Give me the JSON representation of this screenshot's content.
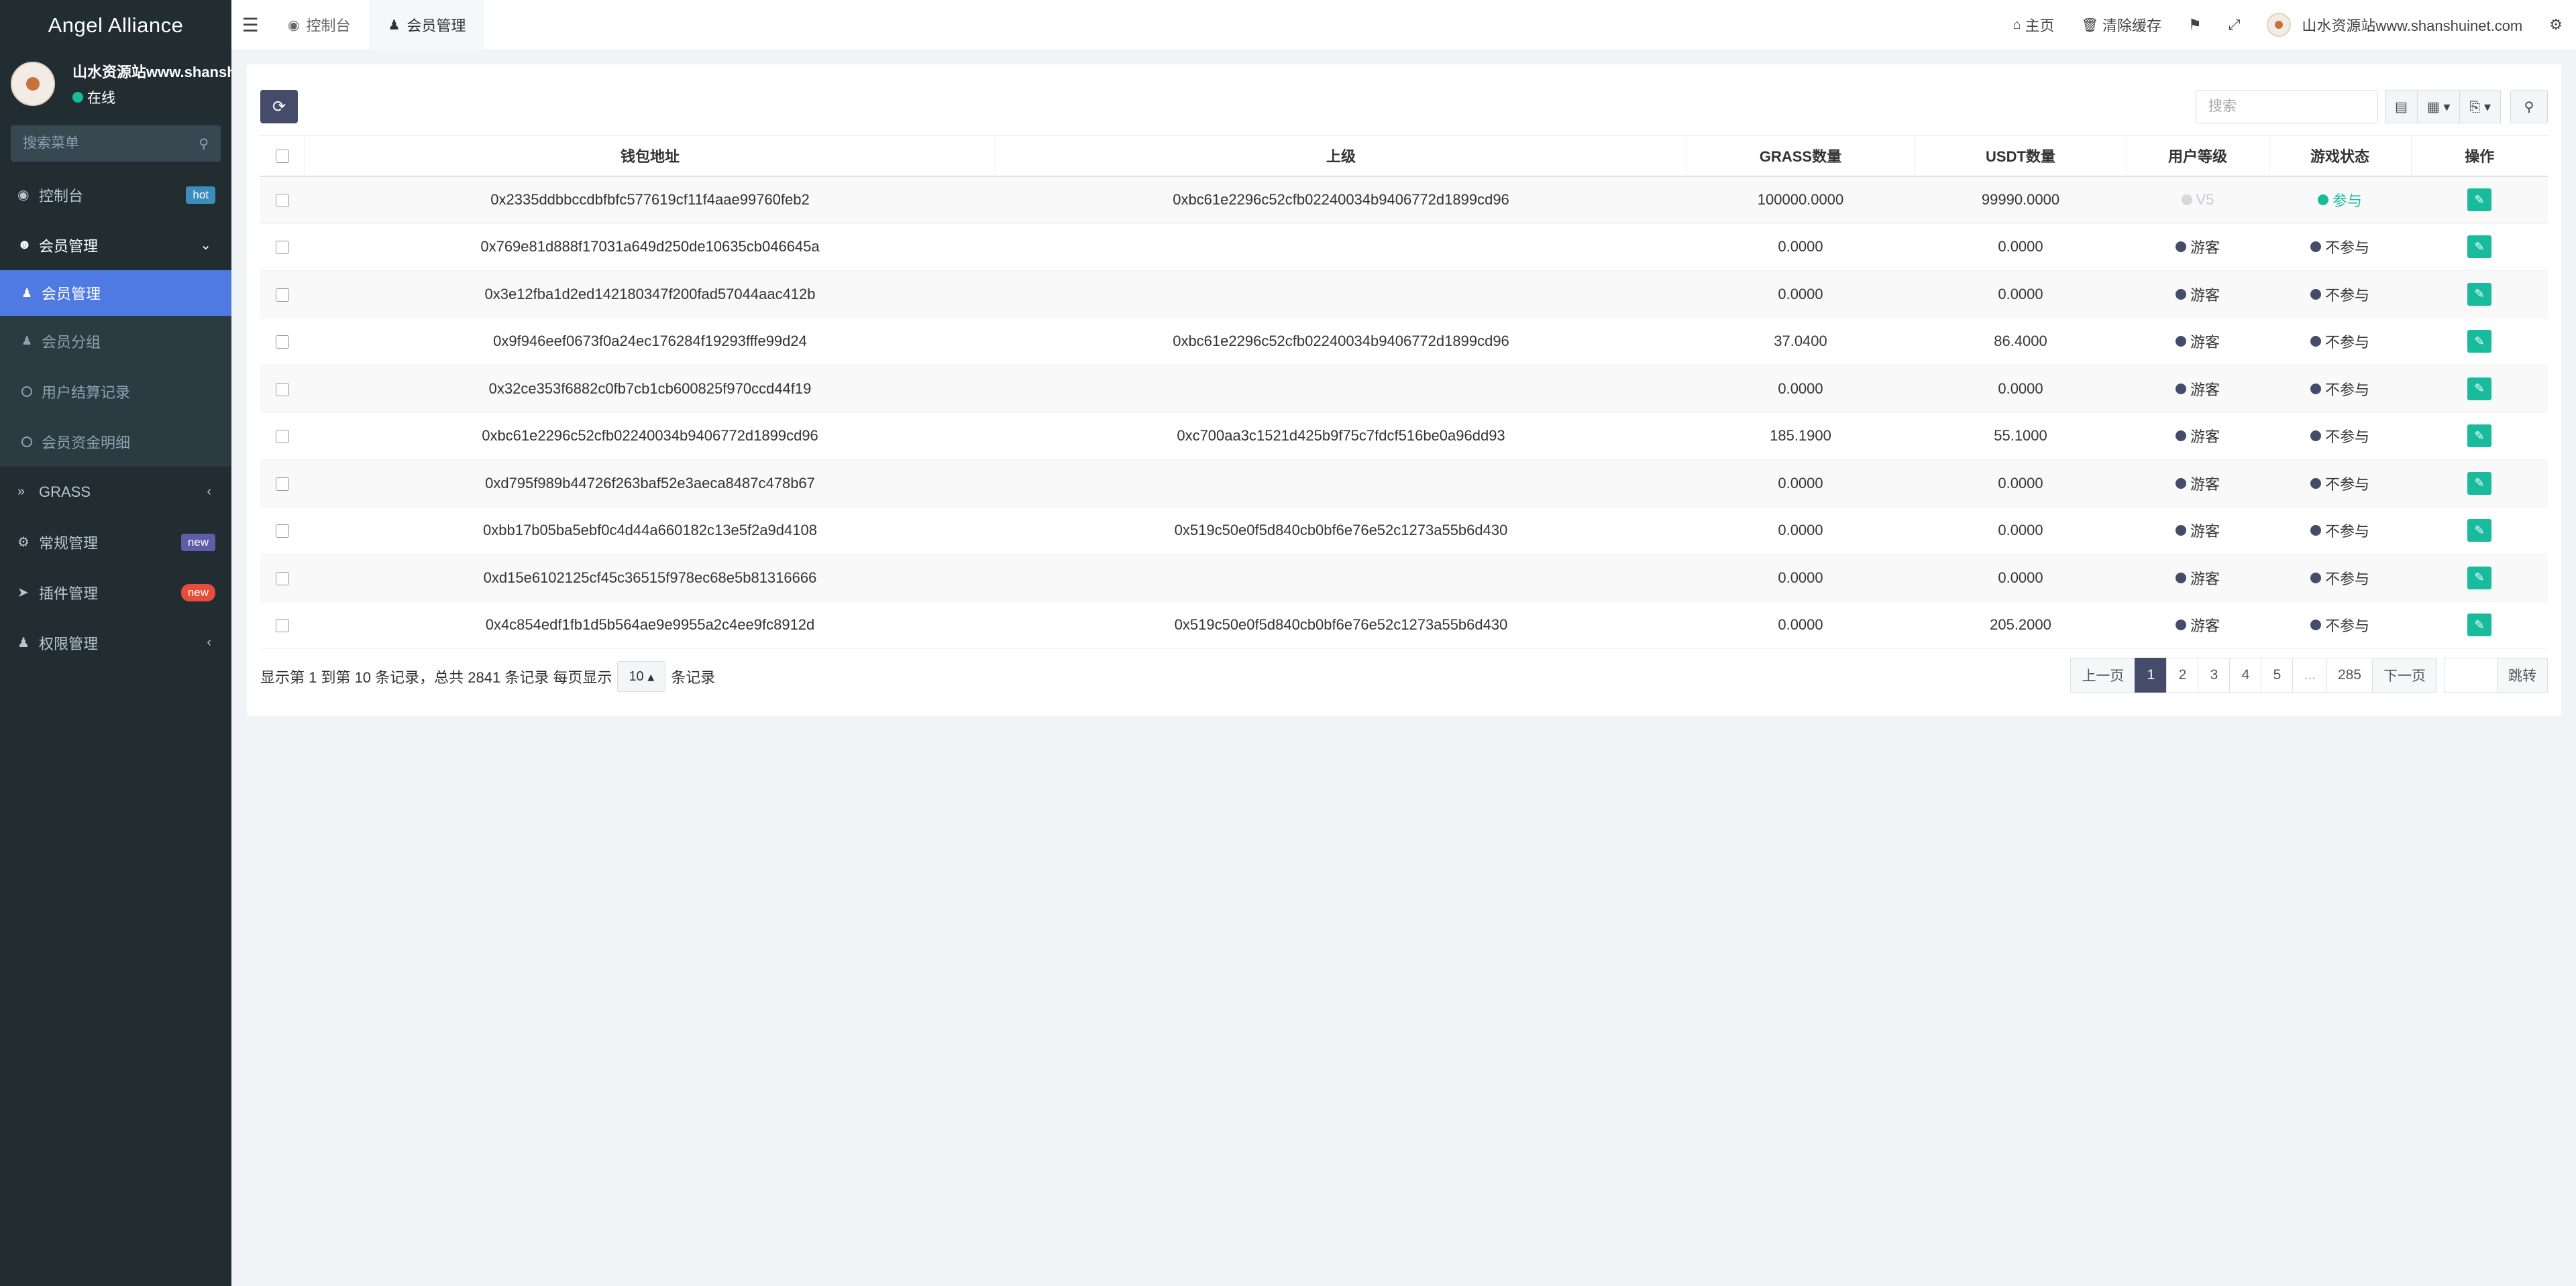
{
  "brand": "Angel Alliance",
  "user": {
    "name": "山水资源站www.shanshuinet.com",
    "status": "在线"
  },
  "sidebar": {
    "search_placeholder": "搜索菜单",
    "items": [
      {
        "label": "控制台",
        "badge": "hot"
      },
      {
        "label": "会员管理"
      },
      {
        "label": "GRASS"
      },
      {
        "label": "常规管理",
        "badge": "new"
      },
      {
        "label": "插件管理",
        "badge": "new"
      },
      {
        "label": "权限管理"
      }
    ],
    "submenu": [
      {
        "label": "会员管理"
      },
      {
        "label": "会员分组"
      },
      {
        "label": "用户结算记录"
      },
      {
        "label": "会员资金明细"
      }
    ]
  },
  "topbar": {
    "tabs": [
      {
        "label": "控制台"
      },
      {
        "label": "会员管理"
      }
    ],
    "home": "主页",
    "clear_cache": "清除缓存",
    "username": "山水资源站www.shanshuinet.com"
  },
  "toolbar": {
    "search_placeholder": "搜索"
  },
  "table": {
    "headers": [
      "钱包地址",
      "上级",
      "GRASS数量",
      "USDT数量",
      "用户等级",
      "游戏状态",
      "操作"
    ],
    "rows": [
      {
        "wallet": "0x2335ddbbccdbfbfc577619cf11f4aae99760feb2",
        "parent": "0xbc61e2296c52cfb02240034b9406772d1899cd96",
        "grass": "100000.0000",
        "usdt": "99990.0000",
        "level": "V5",
        "state": "参与"
      },
      {
        "wallet": "0x769e81d888f17031a649d250de10635cb046645a",
        "parent": "",
        "grass": "0.0000",
        "usdt": "0.0000",
        "level": "游客",
        "state": "不参与"
      },
      {
        "wallet": "0x3e12fba1d2ed142180347f200fad57044aac412b",
        "parent": "",
        "grass": "0.0000",
        "usdt": "0.0000",
        "level": "游客",
        "state": "不参与"
      },
      {
        "wallet": "0x9f946eef0673f0a24ec176284f19293fffe99d24",
        "parent": "0xbc61e2296c52cfb02240034b9406772d1899cd96",
        "grass": "37.0400",
        "usdt": "86.4000",
        "level": "游客",
        "state": "不参与"
      },
      {
        "wallet": "0x32ce353f6882c0fb7cb1cb600825f970ccd44f19",
        "parent": "",
        "grass": "0.0000",
        "usdt": "0.0000",
        "level": "游客",
        "state": "不参与"
      },
      {
        "wallet": "0xbc61e2296c52cfb02240034b9406772d1899cd96",
        "parent": "0xc700aa3c1521d425b9f75c7fdcf516be0a96dd93",
        "grass": "185.1900",
        "usdt": "55.1000",
        "level": "游客",
        "state": "不参与"
      },
      {
        "wallet": "0xd795f989b44726f263baf52e3aeca8487c478b67",
        "parent": "",
        "grass": "0.0000",
        "usdt": "0.0000",
        "level": "游客",
        "state": "不参与"
      },
      {
        "wallet": "0xbb17b05ba5ebf0c4d44a660182c13e5f2a9d4108",
        "parent": "0x519c50e0f5d840cb0bf6e76e52c1273a55b6d430",
        "grass": "0.0000",
        "usdt": "0.0000",
        "level": "游客",
        "state": "不参与"
      },
      {
        "wallet": "0xd15e6102125cf45c36515f978ec68e5b81316666",
        "parent": "",
        "grass": "0.0000",
        "usdt": "0.0000",
        "level": "游客",
        "state": "不参与"
      },
      {
        "wallet": "0x4c854edf1fb1d5b564ae9e9955a2c4ee9fc8912d",
        "parent": "0x519c50e0f5d840cb0bf6e76e52c1273a55b6d430",
        "grass": "0.0000",
        "usdt": "205.2000",
        "level": "游客",
        "state": "不参与"
      }
    ]
  },
  "footer": {
    "summary": "显示第 1 到第 10 条记录，总共 2841 条记录 每页显示",
    "page_size": "10",
    "suffix": "条记录"
  },
  "pagination": {
    "prev": "上一页",
    "pages": [
      "1",
      "2",
      "3",
      "4",
      "5",
      "...",
      "285"
    ],
    "current": "1",
    "next": "下一页",
    "jump": "跳转"
  },
  "colors": {
    "sidebar_bg": "#222d32",
    "active_menu": "#4f7ae1",
    "accent_green": "#18bc9c",
    "primary_dark": "#444c69"
  }
}
